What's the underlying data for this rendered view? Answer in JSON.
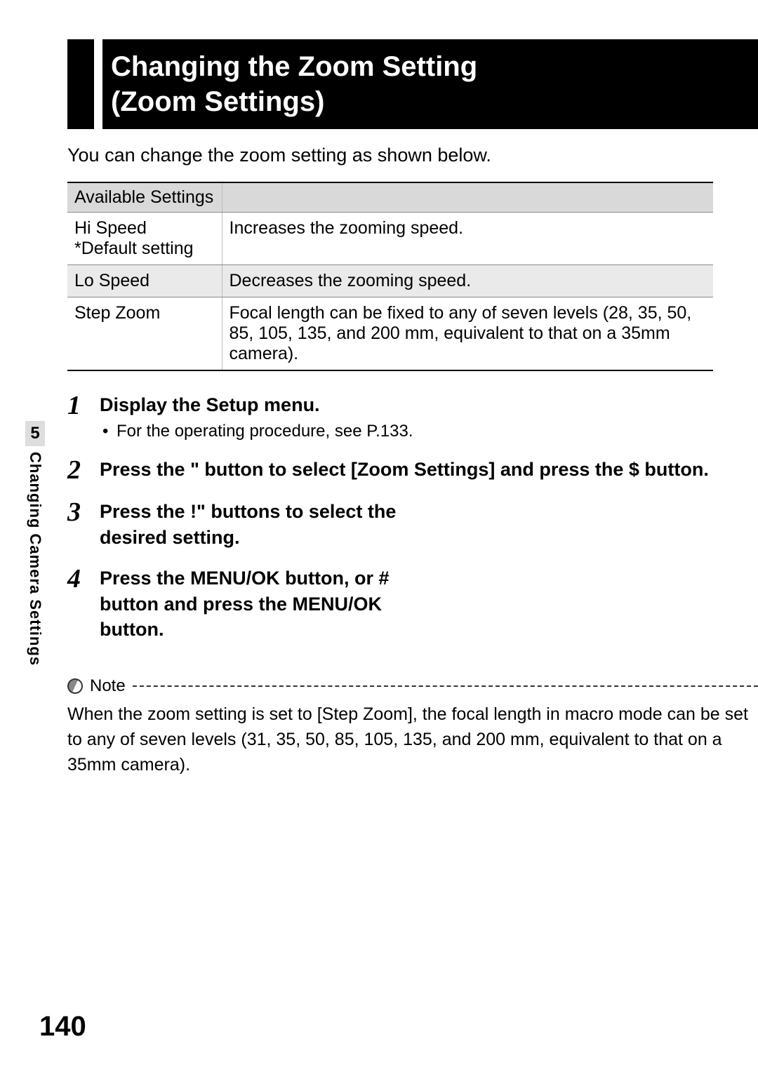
{
  "title": {
    "line1": "Changing the Zoom Setting",
    "line2": "(Zoom Settings)"
  },
  "intro": "You can change the zoom setting as shown below.",
  "table": {
    "header": "Available Settings",
    "rows": [
      {
        "name": "Hi Speed\n*Default setting",
        "desc": "Increases the zooming speed."
      },
      {
        "name": "Lo Speed",
        "desc": "Decreases the zooming speed."
      },
      {
        "name": "Step Zoom",
        "desc": "Focal length can be fixed to any of seven levels (28, 35, 50, 85, 105, 135, and 200 mm, equivalent to that on a 35mm camera)."
      }
    ]
  },
  "steps": [
    {
      "num": "1",
      "title": "Display the Setup menu.",
      "sub": "For the operating procedure, see P.133."
    },
    {
      "num": "2",
      "title": "Press the \" button to select [Zoom Settings] and press the $ button."
    },
    {
      "num": "3",
      "title": "Press the !\" buttons to select the desired setting."
    },
    {
      "num": "4",
      "title": "Press the MENU/OK button, or # button and press the MENU/OK button."
    }
  ],
  "note": {
    "label": "Note",
    "text": "When the zoom setting is set to [Step Zoom], the focal length in macro mode can be set to any of seven levels (31, 35, 50, 85, 105, 135, and 200 mm, equivalent to that on a 35mm camera)."
  },
  "sidebar": {
    "chapter_num": "5",
    "chapter_label": "Changing Camera Settings"
  },
  "page_number": "140"
}
